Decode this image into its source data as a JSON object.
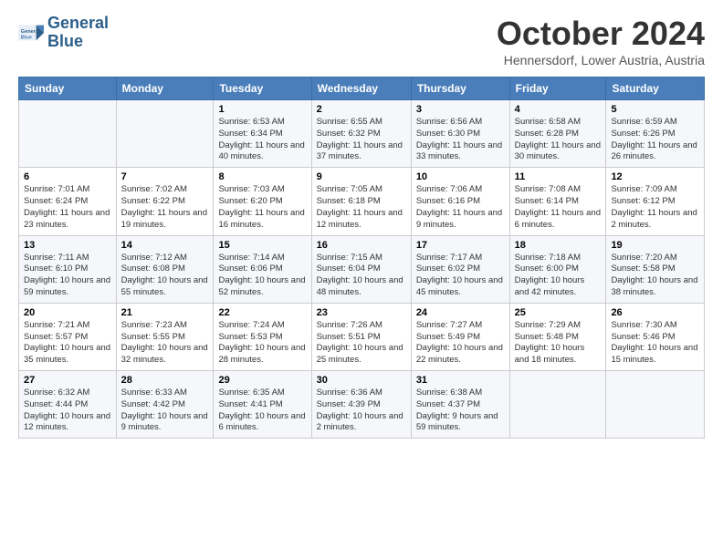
{
  "logo": {
    "line1": "General",
    "line2": "Blue"
  },
  "title": "October 2024",
  "subtitle": "Hennersdorf, Lower Austria, Austria",
  "weekdays": [
    "Sunday",
    "Monday",
    "Tuesday",
    "Wednesday",
    "Thursday",
    "Friday",
    "Saturday"
  ],
  "weeks": [
    [
      {
        "day": "",
        "info": ""
      },
      {
        "day": "",
        "info": ""
      },
      {
        "day": "1",
        "info": "Sunrise: 6:53 AM\nSunset: 6:34 PM\nDaylight: 11 hours and 40 minutes."
      },
      {
        "day": "2",
        "info": "Sunrise: 6:55 AM\nSunset: 6:32 PM\nDaylight: 11 hours and 37 minutes."
      },
      {
        "day": "3",
        "info": "Sunrise: 6:56 AM\nSunset: 6:30 PM\nDaylight: 11 hours and 33 minutes."
      },
      {
        "day": "4",
        "info": "Sunrise: 6:58 AM\nSunset: 6:28 PM\nDaylight: 11 hours and 30 minutes."
      },
      {
        "day": "5",
        "info": "Sunrise: 6:59 AM\nSunset: 6:26 PM\nDaylight: 11 hours and 26 minutes."
      }
    ],
    [
      {
        "day": "6",
        "info": "Sunrise: 7:01 AM\nSunset: 6:24 PM\nDaylight: 11 hours and 23 minutes."
      },
      {
        "day": "7",
        "info": "Sunrise: 7:02 AM\nSunset: 6:22 PM\nDaylight: 11 hours and 19 minutes."
      },
      {
        "day": "8",
        "info": "Sunrise: 7:03 AM\nSunset: 6:20 PM\nDaylight: 11 hours and 16 minutes."
      },
      {
        "day": "9",
        "info": "Sunrise: 7:05 AM\nSunset: 6:18 PM\nDaylight: 11 hours and 12 minutes."
      },
      {
        "day": "10",
        "info": "Sunrise: 7:06 AM\nSunset: 6:16 PM\nDaylight: 11 hours and 9 minutes."
      },
      {
        "day": "11",
        "info": "Sunrise: 7:08 AM\nSunset: 6:14 PM\nDaylight: 11 hours and 6 minutes."
      },
      {
        "day": "12",
        "info": "Sunrise: 7:09 AM\nSunset: 6:12 PM\nDaylight: 11 hours and 2 minutes."
      }
    ],
    [
      {
        "day": "13",
        "info": "Sunrise: 7:11 AM\nSunset: 6:10 PM\nDaylight: 10 hours and 59 minutes."
      },
      {
        "day": "14",
        "info": "Sunrise: 7:12 AM\nSunset: 6:08 PM\nDaylight: 10 hours and 55 minutes."
      },
      {
        "day": "15",
        "info": "Sunrise: 7:14 AM\nSunset: 6:06 PM\nDaylight: 10 hours and 52 minutes."
      },
      {
        "day": "16",
        "info": "Sunrise: 7:15 AM\nSunset: 6:04 PM\nDaylight: 10 hours and 48 minutes."
      },
      {
        "day": "17",
        "info": "Sunrise: 7:17 AM\nSunset: 6:02 PM\nDaylight: 10 hours and 45 minutes."
      },
      {
        "day": "18",
        "info": "Sunrise: 7:18 AM\nSunset: 6:00 PM\nDaylight: 10 hours and 42 minutes."
      },
      {
        "day": "19",
        "info": "Sunrise: 7:20 AM\nSunset: 5:58 PM\nDaylight: 10 hours and 38 minutes."
      }
    ],
    [
      {
        "day": "20",
        "info": "Sunrise: 7:21 AM\nSunset: 5:57 PM\nDaylight: 10 hours and 35 minutes."
      },
      {
        "day": "21",
        "info": "Sunrise: 7:23 AM\nSunset: 5:55 PM\nDaylight: 10 hours and 32 minutes."
      },
      {
        "day": "22",
        "info": "Sunrise: 7:24 AM\nSunset: 5:53 PM\nDaylight: 10 hours and 28 minutes."
      },
      {
        "day": "23",
        "info": "Sunrise: 7:26 AM\nSunset: 5:51 PM\nDaylight: 10 hours and 25 minutes."
      },
      {
        "day": "24",
        "info": "Sunrise: 7:27 AM\nSunset: 5:49 PM\nDaylight: 10 hours and 22 minutes."
      },
      {
        "day": "25",
        "info": "Sunrise: 7:29 AM\nSunset: 5:48 PM\nDaylight: 10 hours and 18 minutes."
      },
      {
        "day": "26",
        "info": "Sunrise: 7:30 AM\nSunset: 5:46 PM\nDaylight: 10 hours and 15 minutes."
      }
    ],
    [
      {
        "day": "27",
        "info": "Sunrise: 6:32 AM\nSunset: 4:44 PM\nDaylight: 10 hours and 12 minutes."
      },
      {
        "day": "28",
        "info": "Sunrise: 6:33 AM\nSunset: 4:42 PM\nDaylight: 10 hours and 9 minutes."
      },
      {
        "day": "29",
        "info": "Sunrise: 6:35 AM\nSunset: 4:41 PM\nDaylight: 10 hours and 6 minutes."
      },
      {
        "day": "30",
        "info": "Sunrise: 6:36 AM\nSunset: 4:39 PM\nDaylight: 10 hours and 2 minutes."
      },
      {
        "day": "31",
        "info": "Sunrise: 6:38 AM\nSunset: 4:37 PM\nDaylight: 9 hours and 59 minutes."
      },
      {
        "day": "",
        "info": ""
      },
      {
        "day": "",
        "info": ""
      }
    ]
  ]
}
